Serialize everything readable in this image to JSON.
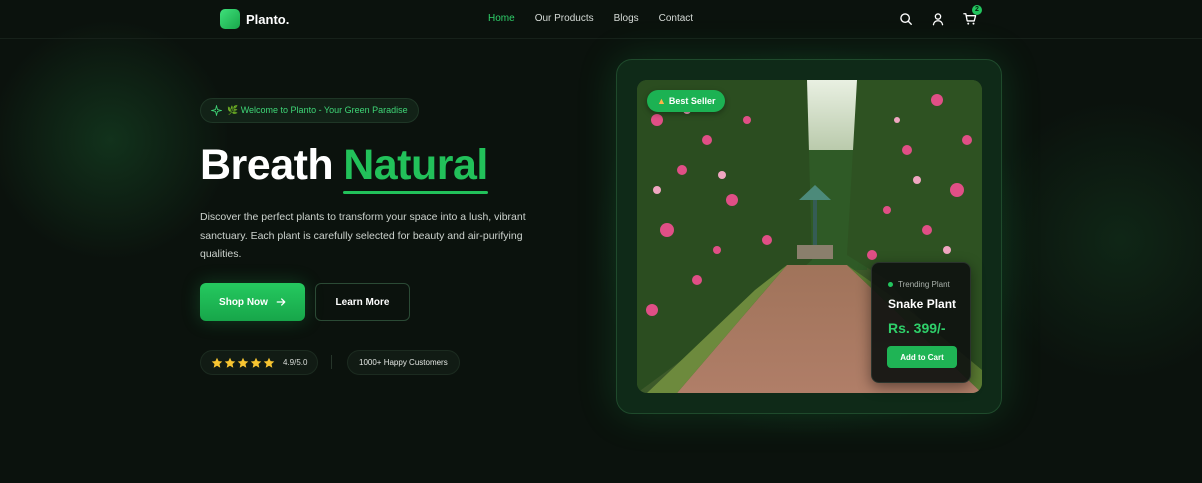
{
  "brand": {
    "name": "Planto."
  },
  "nav": {
    "items": [
      {
        "label": "Home",
        "active": true
      },
      {
        "label": "Our Products",
        "active": false
      },
      {
        "label": "Blogs",
        "active": false
      },
      {
        "label": "Contact",
        "active": false
      }
    ],
    "icons": [
      "search-icon",
      "user-icon",
      "cart-icon"
    ],
    "cart_count": "2"
  },
  "hero": {
    "badge": "🌿 Welcome to Planto - Your Green Paradise",
    "title_part1": "Breath",
    "title_part2": "Natural",
    "description": "Discover the perfect plants to transform your space into a lush, vibrant sanctuary. Each plant is carefully selected for beauty and air-purifying qualities.",
    "primary_button": "Shop Now",
    "secondary_button": "Learn More",
    "rating": {
      "stars": 5,
      "value": "4.9/5.0"
    },
    "customers": "1000+ Happy Customers"
  },
  "showcase": {
    "badge": "Best Seller",
    "card": {
      "tag": "Trending Plant",
      "name": "Snake Plant",
      "price": "Rs. 399/-",
      "button": "Add to Cart"
    }
  },
  "colors": {
    "accent": "#22c55e",
    "background": "#0b120d",
    "text": "#ffffff"
  }
}
